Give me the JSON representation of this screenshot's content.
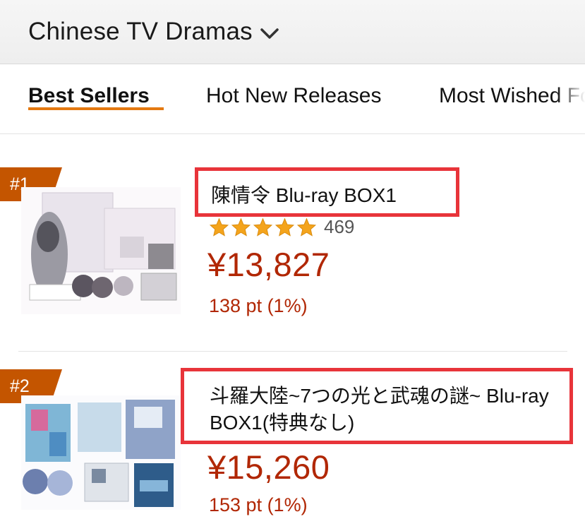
{
  "header": {
    "category_title": "Chinese TV Dramas"
  },
  "tabs": [
    {
      "label": "Best Sellers",
      "active": true
    },
    {
      "label": "Hot New Releases",
      "active": false
    },
    {
      "label": "Most Wished For",
      "active": false
    }
  ],
  "items": [
    {
      "rank": "#1",
      "title": "陳情令 Blu-ray BOX1",
      "rating_stars": 5,
      "rating_count": "469",
      "price": "¥13,827",
      "points": "138 pt (1%)"
    },
    {
      "rank": "#2",
      "title": "斗羅大陸~7つの光と武魂の謎~ Blu-ray BOX1(特典なし)",
      "price": "¥15,260",
      "points": "153 pt (1%)"
    }
  ],
  "colors": {
    "accent_orange": "#e47911",
    "rank_badge": "#c45500",
    "price_red": "#b12704",
    "highlight_box": "#e8343a",
    "star": "#f4a41c"
  },
  "icons": [
    "chevron-down-icon",
    "star-icon"
  ]
}
